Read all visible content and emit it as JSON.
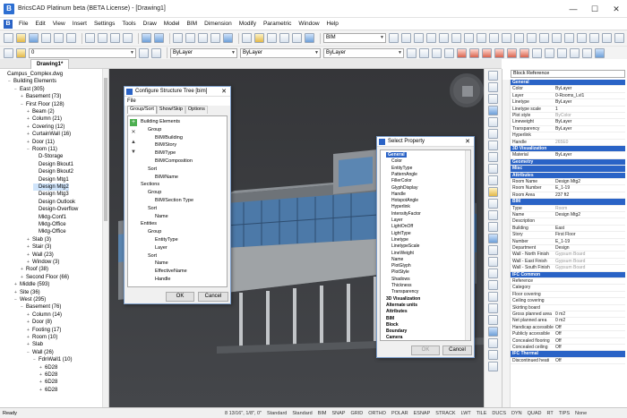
{
  "window": {
    "title": "BricsCAD Platinum beta (BETA License) - [Drawing1]",
    "min": "—",
    "max": "☐",
    "close": "✕"
  },
  "menu": [
    "File",
    "Edit",
    "View",
    "Insert",
    "Settings",
    "Tools",
    "Draw",
    "Model",
    "BIM",
    "Dimension",
    "Modify",
    "Parametric",
    "Window",
    "Help"
  ],
  "toolbar": {
    "layer_value": "BIM",
    "layer2_value": "0",
    "color": "ByLayer",
    "linetype": "ByLayer",
    "lineweight": "ByLayer"
  },
  "tabs": [
    "Drawing1*"
  ],
  "structure_tree": [
    {
      "label": "Campus_Complex.dwg",
      "indent": 0,
      "toggle": ""
    },
    {
      "label": "Building Elements",
      "indent": 1,
      "toggle": "−"
    },
    {
      "label": "East (305)",
      "indent": 2,
      "toggle": "−"
    },
    {
      "label": "Basement (73)",
      "indent": 3,
      "toggle": "+"
    },
    {
      "label": "First Floor (128)",
      "indent": 3,
      "toggle": "−"
    },
    {
      "label": "Beam (2)",
      "indent": 4,
      "toggle": "+"
    },
    {
      "label": "Column (21)",
      "indent": 4,
      "toggle": "+"
    },
    {
      "label": "Covering (12)",
      "indent": 4,
      "toggle": "+"
    },
    {
      "label": "CurtainWall (16)",
      "indent": 4,
      "toggle": "+"
    },
    {
      "label": "Door (11)",
      "indent": 4,
      "toggle": "+"
    },
    {
      "label": "Room (11)",
      "indent": 4,
      "toggle": "−"
    },
    {
      "label": "D-Storage",
      "indent": 5,
      "toggle": ""
    },
    {
      "label": "Design Bkout1",
      "indent": 5,
      "toggle": ""
    },
    {
      "label": "Design Bkout2",
      "indent": 5,
      "toggle": ""
    },
    {
      "label": "Design Mtg1",
      "indent": 5,
      "toggle": ""
    },
    {
      "label": "Design Mtg2",
      "indent": 5,
      "toggle": "",
      "selected": true
    },
    {
      "label": "Design Mtg3",
      "indent": 5,
      "toggle": ""
    },
    {
      "label": "Design Outlook",
      "indent": 5,
      "toggle": ""
    },
    {
      "label": "Design-Overflow",
      "indent": 5,
      "toggle": ""
    },
    {
      "label": "Mktg-Conf1",
      "indent": 5,
      "toggle": ""
    },
    {
      "label": "Mktg-Office",
      "indent": 5,
      "toggle": ""
    },
    {
      "label": "Mktg-Office",
      "indent": 5,
      "toggle": ""
    },
    {
      "label": "Slab (3)",
      "indent": 4,
      "toggle": "+"
    },
    {
      "label": "Stair (3)",
      "indent": 4,
      "toggle": "+"
    },
    {
      "label": "Wall (23)",
      "indent": 4,
      "toggle": "+"
    },
    {
      "label": "Window (3)",
      "indent": 4,
      "toggle": "+"
    },
    {
      "label": "Roof (38)",
      "indent": 3,
      "toggle": "+"
    },
    {
      "label": "Second Floor (66)",
      "indent": 3,
      "toggle": "+"
    },
    {
      "label": "Middle (593)",
      "indent": 2,
      "toggle": "+"
    },
    {
      "label": "Site (36)",
      "indent": 2,
      "toggle": "+"
    },
    {
      "label": "West (295)",
      "indent": 2,
      "toggle": "−"
    },
    {
      "label": "Basement (76)",
      "indent": 3,
      "toggle": "−"
    },
    {
      "label": "Column (14)",
      "indent": 4,
      "toggle": "+"
    },
    {
      "label": "Door (8)",
      "indent": 4,
      "toggle": "+"
    },
    {
      "label": "Footing (17)",
      "indent": 4,
      "toggle": "+"
    },
    {
      "label": "Room (10)",
      "indent": 4,
      "toggle": "+"
    },
    {
      "label": "Slab",
      "indent": 4,
      "toggle": "+"
    },
    {
      "label": "Wall (26)",
      "indent": 4,
      "toggle": "−"
    },
    {
      "label": "FdnWall1 (10)",
      "indent": 5,
      "toggle": "−"
    },
    {
      "label": "6D28",
      "indent": 6,
      "toggle": "+"
    },
    {
      "label": "6D28",
      "indent": 6,
      "toggle": "+"
    },
    {
      "label": "6D28",
      "indent": 6,
      "toggle": "+"
    },
    {
      "label": "6D28",
      "indent": 6,
      "toggle": "+"
    }
  ],
  "config_dialog": {
    "title": "Configure Structure Tree [bim]",
    "menu": "File",
    "tabs": [
      "Group/Sort",
      "Show/Skip",
      "Options"
    ],
    "items": [
      {
        "label": "Building Elements",
        "indent": 0
      },
      {
        "label": "Group",
        "indent": 1
      },
      {
        "label": "BIM/Building",
        "indent": 2
      },
      {
        "label": "BIM/Story",
        "indent": 2
      },
      {
        "label": "BIM/Type",
        "indent": 2
      },
      {
        "label": "BIM/Composition",
        "indent": 2
      },
      {
        "label": "Sort",
        "indent": 1
      },
      {
        "label": "BIM/Name",
        "indent": 2
      },
      {
        "label": "Sections",
        "indent": 0
      },
      {
        "label": "Group",
        "indent": 1
      },
      {
        "label": "BIM/Section Type",
        "indent": 2
      },
      {
        "label": "Sort",
        "indent": 1
      },
      {
        "label": "Name",
        "indent": 2
      },
      {
        "label": "Entities",
        "indent": 0
      },
      {
        "label": "Group",
        "indent": 1
      },
      {
        "label": "EntityType",
        "indent": 2
      },
      {
        "label": "Layer",
        "indent": 2
      },
      {
        "label": "Sort",
        "indent": 1
      },
      {
        "label": "Name",
        "indent": 2
      },
      {
        "label": "EffectiveName",
        "indent": 2
      },
      {
        "label": "Handle",
        "indent": 2
      }
    ],
    "ok": "OK",
    "cancel": "Cancel"
  },
  "select_dialog": {
    "title": "Select Property",
    "items": [
      {
        "label": "General",
        "bold": true,
        "selected": true
      },
      {
        "label": "Color"
      },
      {
        "label": "EntityType"
      },
      {
        "label": "PatternAngle"
      },
      {
        "label": "FillerColor"
      },
      {
        "label": "GlyphDisplay"
      },
      {
        "label": "Handle"
      },
      {
        "label": "HotspotAngle"
      },
      {
        "label": "Hyperlink"
      },
      {
        "label": "IntensityFactor"
      },
      {
        "label": "Layer"
      },
      {
        "label": "LightOnOff"
      },
      {
        "label": "LightType"
      },
      {
        "label": "Linetype"
      },
      {
        "label": "LinetypeScale"
      },
      {
        "label": "LineWeight"
      },
      {
        "label": "Name"
      },
      {
        "label": "PlotGlyph"
      },
      {
        "label": "PlotStyle"
      },
      {
        "label": "Shadows"
      },
      {
        "label": "Thickness"
      },
      {
        "label": "Transparency"
      },
      {
        "label": "3D Visualization",
        "bold": true
      },
      {
        "label": "Alternate units",
        "bold": true
      },
      {
        "label": "Attributes",
        "bold": true
      },
      {
        "label": "BIM",
        "bold": true
      },
      {
        "label": "Block",
        "bold": true
      },
      {
        "label": "Boundary",
        "bold": true
      },
      {
        "label": "Camera",
        "bold": true
      }
    ],
    "ok": "OK",
    "cancel": "Cancel"
  },
  "properties": {
    "selector": "Block Reference",
    "rows": [
      {
        "k": "General",
        "hdr": true
      },
      {
        "k": "Color",
        "v": "ByLayer"
      },
      {
        "k": "Layer",
        "v": "0-Rooms_Lvl1"
      },
      {
        "k": "Linetype",
        "v": "ByLayer"
      },
      {
        "k": "Linetype scale",
        "v": "1"
      },
      {
        "k": "Plot style",
        "v": "ByColor",
        "grey": true
      },
      {
        "k": "Lineweight",
        "v": "ByLayer"
      },
      {
        "k": "Transparency",
        "v": "ByLayer"
      },
      {
        "k": "Hyperlink",
        "v": ""
      },
      {
        "k": "Handle",
        "v": "265E0",
        "grey": true
      },
      {
        "k": "3D Visualization",
        "hdr": true
      },
      {
        "k": "Material",
        "v": "ByLayer"
      },
      {
        "k": "Geometry",
        "hdr": true
      },
      {
        "k": "Misc",
        "hdr": true
      },
      {
        "k": "Attributes",
        "hdr": true
      },
      {
        "k": "Room Name",
        "v": "Design Mtg2"
      },
      {
        "k": "Room Number",
        "v": "E_1-19"
      },
      {
        "k": "Room Area",
        "v": "237 ft2"
      },
      {
        "k": "BIM",
        "hdr": true
      },
      {
        "k": "Type",
        "v": "Room",
        "grey": true
      },
      {
        "k": "Name",
        "v": "Design Mtg2"
      },
      {
        "k": "Description",
        "v": ""
      },
      {
        "k": "Building",
        "v": "East"
      },
      {
        "k": "Story",
        "v": "First Floor"
      },
      {
        "k": "Number",
        "v": "E_1-19"
      },
      {
        "k": "Department",
        "v": "Design"
      },
      {
        "k": "Wall - North Finish",
        "v": "Gypsum Board",
        "grey": true
      },
      {
        "k": "Wall - East Finish",
        "v": "Gypsum Board",
        "grey": true
      },
      {
        "k": "Wall - South Finish",
        "v": "Gypsum Board",
        "grey": true
      },
      {
        "k": "IFC Common",
        "hdr": true
      },
      {
        "k": "Reference",
        "v": ""
      },
      {
        "k": "Category",
        "v": ""
      },
      {
        "k": "Floor covering",
        "v": ""
      },
      {
        "k": "Ceiling covering",
        "v": ""
      },
      {
        "k": "Skirting board",
        "v": ""
      },
      {
        "k": "Gross planned area",
        "v": "0 m2"
      },
      {
        "k": "Net planned area",
        "v": "0 m2"
      },
      {
        "k": "Handicap accessible",
        "v": "Off"
      },
      {
        "k": "Publicly accessible",
        "v": "Off"
      },
      {
        "k": "Concealed flooring",
        "v": "Off"
      },
      {
        "k": "Concealed ceiling",
        "v": "Off"
      },
      {
        "k": "IFC Thermal",
        "hdr": true
      },
      {
        "k": "Discontinued heati",
        "v": "Off"
      }
    ]
  },
  "status": {
    "left": "Ready",
    "coords": "8 13/16\", 1/8\", 0\"",
    "items": [
      "Standard",
      "Standard",
      "BIM",
      "SNAP",
      "GRID",
      "ORTHO",
      "POLAR",
      "ESNAP",
      "STRACK",
      "LWT",
      "TILE",
      "DUCS",
      "DYN",
      "QUAD",
      "RT",
      "TIPS",
      "None"
    ]
  }
}
